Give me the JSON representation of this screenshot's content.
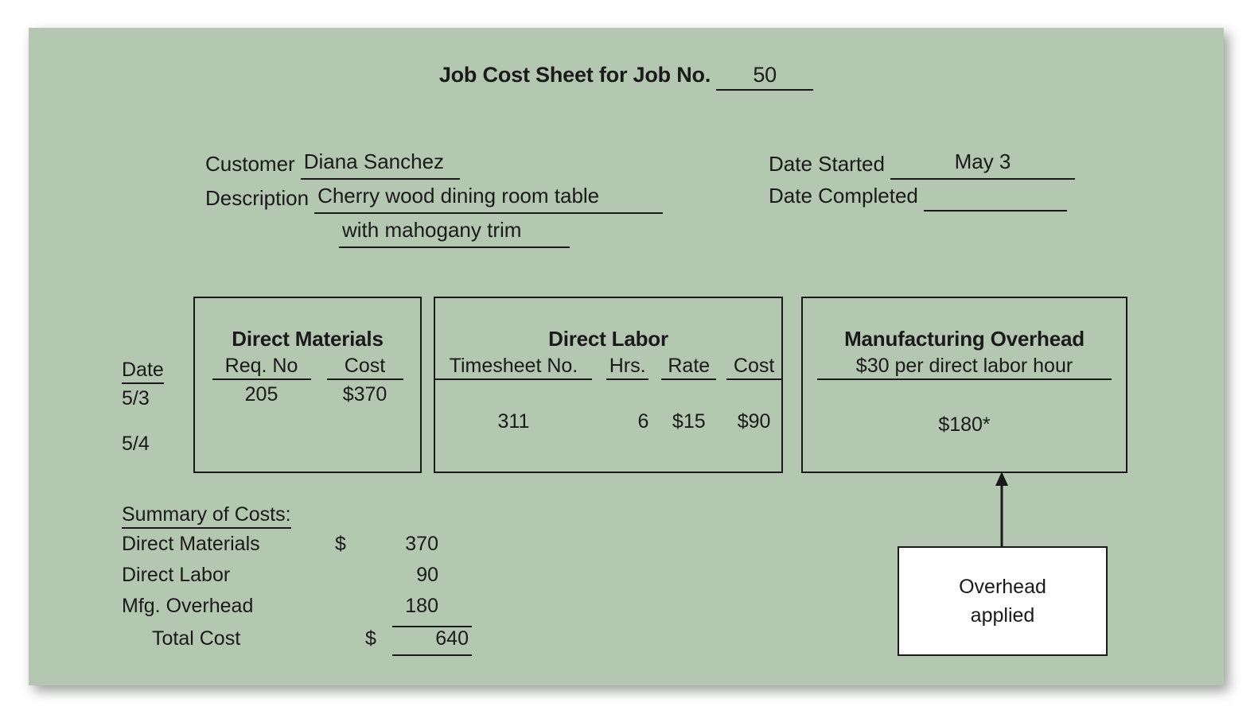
{
  "document": {
    "title_prefix": "Job Cost Sheet for Job No.",
    "job_number": "50",
    "background_color": "#b4c7b0"
  },
  "header": {
    "customer_label": "Customer",
    "customer_value": "Diana Sanchez",
    "description_label": "Description",
    "description_line1": "Cherry wood dining room table",
    "description_line2": "with mahogany trim",
    "date_started_label": "Date Started",
    "date_started_value": "May 3",
    "date_completed_label": "Date Completed",
    "date_completed_value": ""
  },
  "date_column": {
    "header": "Date",
    "rows": [
      "5/3",
      "5/4"
    ]
  },
  "direct_materials": {
    "title": "Direct Materials",
    "columns": [
      "Req. No",
      "Cost"
    ],
    "rows": [
      {
        "req_no": "205",
        "cost": "$370"
      },
      {
        "req_no": "",
        "cost": ""
      }
    ]
  },
  "direct_labor": {
    "title": "Direct Labor",
    "columns": [
      "Timesheet No.",
      "Hrs.",
      "Rate",
      "Cost"
    ],
    "rows": [
      {
        "timesheet_no": "311",
        "hrs": "6",
        "rate": "$15",
        "cost": "$90"
      }
    ]
  },
  "manufacturing_overhead": {
    "title": "Manufacturing Overhead",
    "rate": "$30 per direct labor hour",
    "amount": "$180*"
  },
  "summary": {
    "title": "Summary of Costs:",
    "rows": [
      {
        "label": "Direct Materials",
        "currency": "$",
        "amount": "370"
      },
      {
        "label": "Direct Labor",
        "currency": "",
        "amount": "90"
      },
      {
        "label": "Mfg. Overhead",
        "currency": "",
        "amount": "180"
      },
      {
        "label": "Total Cost",
        "currency": "$",
        "amount": "640"
      }
    ]
  },
  "callout": {
    "line1": "Overhead",
    "line2": "applied"
  }
}
